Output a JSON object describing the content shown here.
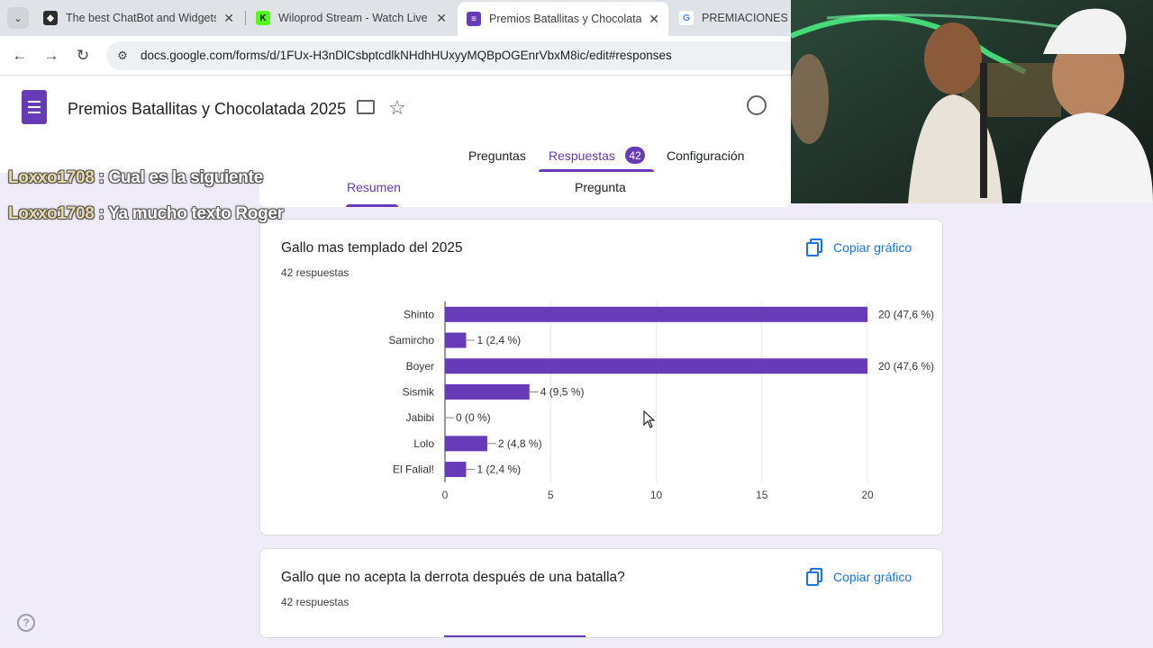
{
  "browser": {
    "tabs": [
      {
        "title": "The best ChatBot and Widgets",
        "favicon_color": "#2d2d2d"
      },
      {
        "title": "Wiloprod Stream - Watch Live",
        "favicon_color": "#53fc18"
      },
      {
        "title": "Premios Batallitas y Chocolatad",
        "favicon_color": "#673ab7"
      },
      {
        "title": "PREMIACIONES AP",
        "favicon_color": "#4285f4"
      }
    ],
    "url": "docs.google.com/forms/d/1FUx-H3nDlCsbptcdlkNHdhHUxyyMQBpOGEnrVbxM8ic/edit#responses"
  },
  "form": {
    "title": "Premios Batallitas y Chocolatada 2025",
    "tabs": {
      "questions": "Preguntas",
      "responses": "Respuestas",
      "responses_count": "42",
      "settings": "Configuración"
    },
    "subtabs": {
      "summary": "Resumen",
      "question": "Pregunta"
    },
    "accent": "#673ab7"
  },
  "chat": [
    {
      "user": "Loxxo1708",
      "message": " : Cual es la siguiente"
    },
    {
      "user": "Loxxo1708",
      "message": " : Ya mucho texto Roger"
    }
  ],
  "cards": [
    {
      "title": "Gallo mas templado del 2025",
      "count": "42 respuestas",
      "copy_label": "Copiar gráfico"
    },
    {
      "title": "Gallo que no acepta la derrota después de una batalla?",
      "count": "42 respuestas",
      "copy_label": "Copiar gráfico"
    }
  ],
  "chart_data": {
    "type": "bar",
    "orientation": "horizontal",
    "title": "Gallo mas templado del 2025",
    "categories": [
      "Shinto",
      "Samircho",
      "Boyer",
      "Sismik",
      "Jabibi",
      "Lolo",
      "El Falial!"
    ],
    "values": [
      20,
      1,
      20,
      4,
      0,
      2,
      1
    ],
    "labels": [
      "20 (47,6 %)",
      "1 (2,4 %)",
      "20 (47,6 %)",
      "4 (9,5 %)",
      "0 (0 %)",
      "2 (4,8 %)",
      "1 (2,4 %)"
    ],
    "xticks": [
      "0",
      "5",
      "10",
      "15",
      "20"
    ],
    "xlim": [
      0,
      20
    ],
    "grid": true,
    "color": "#673ab7"
  }
}
